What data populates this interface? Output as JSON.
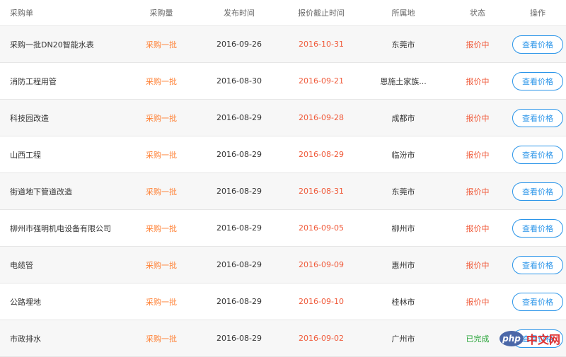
{
  "header": {
    "col_name": "采购单",
    "col_qty": "采购量",
    "col_pub": "发布时间",
    "col_deadline": "报价截止时间",
    "col_location": "所属地",
    "col_status": "状态",
    "col_action": "操作"
  },
  "rows": [
    {
      "name": "采购一批DN20智能水表",
      "qty": "采购一批",
      "pub": "2016-09-26",
      "deadline": "2016-10-31",
      "location": "东莞市",
      "status": "报价中",
      "button": "查看价格"
    },
    {
      "name": "消防工程用管",
      "qty": "采购一批",
      "pub": "2016-08-30",
      "deadline": "2016-09-21",
      "location": "恩施土家族...",
      "status": "报价中",
      "button": "查看价格"
    },
    {
      "name": "科技园改造",
      "qty": "采购一批",
      "pub": "2016-08-29",
      "deadline": "2016-09-28",
      "location": "成都市",
      "status": "报价中",
      "button": "查看价格"
    },
    {
      "name": "山西工程",
      "qty": "采购一批",
      "pub": "2016-08-29",
      "deadline": "2016-08-29",
      "location": "临汾市",
      "status": "报价中",
      "button": "查看价格"
    },
    {
      "name": "街道地下管道改造",
      "qty": "采购一批",
      "pub": "2016-08-29",
      "deadline": "2016-08-31",
      "location": "东莞市",
      "status": "报价中",
      "button": "查看价格"
    },
    {
      "name": "柳州市强明机电设备有限公司",
      "qty": "采购一批",
      "pub": "2016-08-29",
      "deadline": "2016-09-05",
      "location": "柳州市",
      "status": "报价中",
      "button": "查看价格"
    },
    {
      "name": "电缆管",
      "qty": "采购一批",
      "pub": "2016-08-29",
      "deadline": "2016-09-09",
      "location": "惠州市",
      "status": "报价中",
      "button": "查看价格"
    },
    {
      "name": "公路埋地",
      "qty": "采购一批",
      "pub": "2016-08-29",
      "deadline": "2016-09-10",
      "location": "桂林市",
      "status": "报价中",
      "button": "查看价格"
    },
    {
      "name": "市政排水",
      "qty": "采购一批",
      "pub": "2016-08-29",
      "deadline": "2016-09-02",
      "location": "广州市",
      "status": "已完成",
      "button": "查看价格"
    }
  ],
  "watermark": {
    "logo": "php",
    "text": "中文网"
  },
  "colors": {
    "accent": "#2b95e9",
    "orange": "#ff7f32",
    "red": "#f05a3a",
    "done": "#29a539"
  },
  "icons": [
    "php-logo-icon"
  ]
}
